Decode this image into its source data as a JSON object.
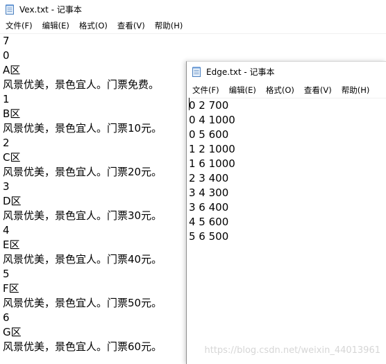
{
  "windows": {
    "vex": {
      "title": "Vex.txt - 记事本",
      "menu": [
        "文件(F)",
        "编辑(E)",
        "格式(O)",
        "查看(V)",
        "帮助(H)"
      ],
      "lines": [
        "7",
        "0",
        "A区",
        "风景优美，景色宜人。门票免费。",
        "1",
        "B区",
        "风景优美，景色宜人。门票10元。",
        "2",
        "C区",
        "风景优美，景色宜人。门票20元。",
        "3",
        "D区",
        "风景优美，景色宜人。门票30元。",
        "4",
        "E区",
        "风景优美，景色宜人。门票40元。",
        "5",
        "F区",
        "风景优美，景色宜人。门票50元。",
        "6",
        "G区",
        "风景优美，景色宜人。门票60元。"
      ]
    },
    "edge": {
      "title": "Edge.txt - 记事本",
      "menu": [
        "文件(F)",
        "编辑(E)",
        "格式(O)",
        "查看(V)",
        "帮助(H)"
      ],
      "lines": [
        "0 2 700",
        "0 4 1000",
        "0 5 600",
        "1 2 1000",
        "1 6 1000",
        "2 3 400",
        "3 4 300",
        "3 6 400",
        "4 5 600",
        "5 6 500"
      ]
    }
  },
  "watermark": "https://blog.csdn.net/weixin_44013961",
  "icons": {
    "app": "notepad-icon"
  }
}
